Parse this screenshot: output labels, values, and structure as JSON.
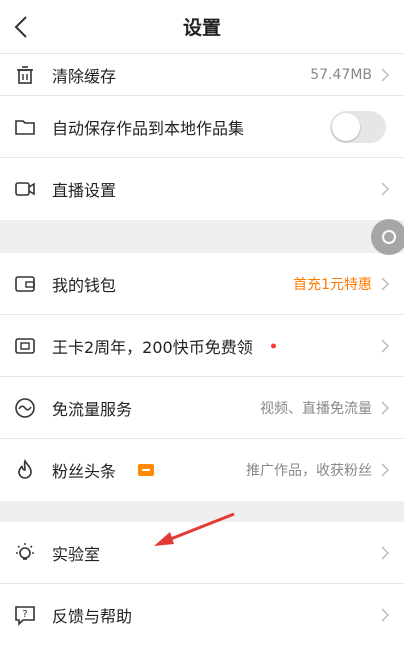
{
  "header": {
    "title": "设置"
  },
  "groups": [
    {
      "items": [
        {
          "label": "清除缓存",
          "value": "57.47MB"
        },
        {
          "label": "自动保存作品到本地作品集",
          "toggle": false
        },
        {
          "label": "直播设置"
        }
      ]
    },
    {
      "items": [
        {
          "label": "我的钱包",
          "value": "首充1元特惠"
        },
        {
          "label": "王卡2周年，200快币免费领"
        },
        {
          "label": "免流量服务",
          "value": "视频、直播免流量"
        },
        {
          "label": "粉丝头条",
          "value": "推广作品，收获粉丝"
        }
      ]
    },
    {
      "items": [
        {
          "label": "实验室"
        },
        {
          "label": "反馈与帮助"
        }
      ]
    }
  ],
  "colors": {
    "accent_orange": "#ff7a00",
    "arrow_red": "#e53935",
    "dot_red": "#ff3b30"
  },
  "icons": [
    "chevron-left-icon",
    "trash-icon",
    "folder-icon",
    "video-camera-icon",
    "wallet-icon",
    "sim-card-icon",
    "flow-wave-icon",
    "flame-icon",
    "lightbulb-icon",
    "help-icon",
    "chevron-right-icon"
  ]
}
